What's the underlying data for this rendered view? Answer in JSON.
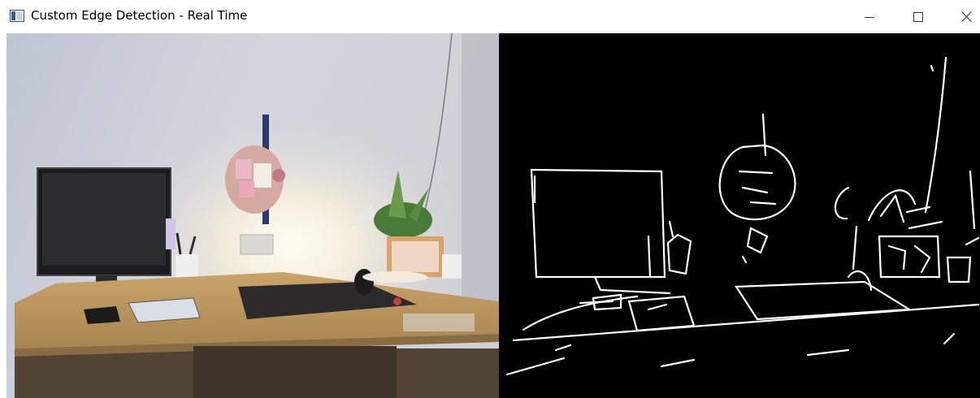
{
  "window": {
    "title": "Custom Edge Detection - Real Time",
    "icons": {
      "app": "app-window-icon",
      "minimize": "minimize-icon",
      "maximize": "maximize-icon",
      "close": "close-icon"
    }
  },
  "panes": {
    "left": {
      "content": "camera-frame"
    },
    "right": {
      "content": "edge-map"
    }
  },
  "colors": {
    "edge_background": "#000000",
    "edge_lines": "#ffffff",
    "titlebar": "#ffffff"
  }
}
